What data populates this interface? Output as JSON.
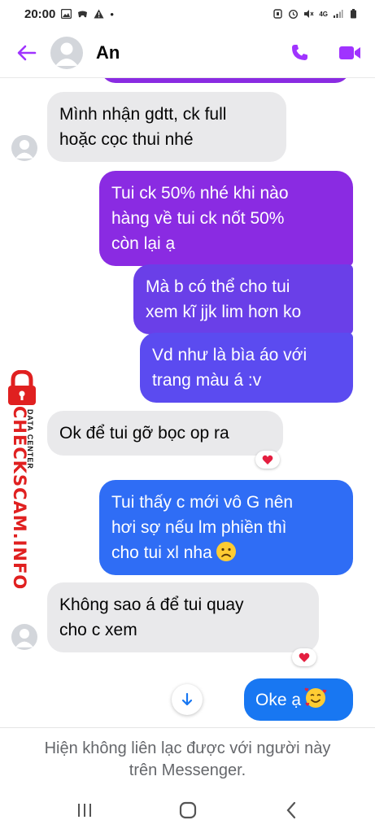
{
  "status_bar": {
    "time": "20:00",
    "dot": "•",
    "network": "4G",
    "icons": [
      "image-icon",
      "game-icon",
      "warning-icon",
      "alarm-icon",
      "battery-saver-icon",
      "signal-icon",
      "battery-icon"
    ]
  },
  "header": {
    "contact_name": "An",
    "accent_color": "#a033ff",
    "icons": [
      "back-arrow-icon",
      "phone-icon",
      "video-icon"
    ]
  },
  "messages": [
    {
      "side": "in",
      "text_lines": [
        "Mình nhận gdtt, ck full",
        "hoặc cọc thui nhé"
      ]
    },
    {
      "side": "out",
      "color": "#8a2be2",
      "text_lines": [
        "Tui ck 50% nhé khi nào",
        "hàng về tui ck nốt 50%",
        "còn lại ạ"
      ]
    },
    {
      "side": "out",
      "color": "#6a3fe8",
      "text_lines": [
        "Mà b có thể cho tui",
        "xem kĩ jjk lim hơn ko"
      ]
    },
    {
      "side": "out",
      "color": "#5b4bf0",
      "text_lines": [
        "Vd như là bìa áo với",
        "trang màu á :v"
      ]
    },
    {
      "side": "in",
      "text_lines": [
        "Ok để tui gỡ bọc op ra"
      ],
      "reaction": "heart"
    },
    {
      "side": "out",
      "color": "#2f6df5",
      "text_lines": [
        "Tui thấy c mới vô G nên",
        "hơi sợ nếu lm phiền thì",
        "cho tui xl nha"
      ],
      "emoji": "frowning-face"
    },
    {
      "side": "in",
      "text_lines": [
        "Không sao á để tui quay",
        "cho c xem"
      ],
      "reaction": "heart"
    },
    {
      "side": "out",
      "color": "#1877f2",
      "text_lines": [
        "Oke ạ"
      ],
      "emoji": "smiling-face-with-hearts"
    }
  ],
  "watermark": {
    "brand": "CHECKSCAM.INFO",
    "sub": "DATA CENTER",
    "color": "#e02020"
  },
  "footer": {
    "notice": "Hiện không liên lạc được với người này trên Messenger."
  },
  "nav_bar": {
    "icons": [
      "recent-apps-icon",
      "home-icon",
      "back-icon"
    ]
  }
}
